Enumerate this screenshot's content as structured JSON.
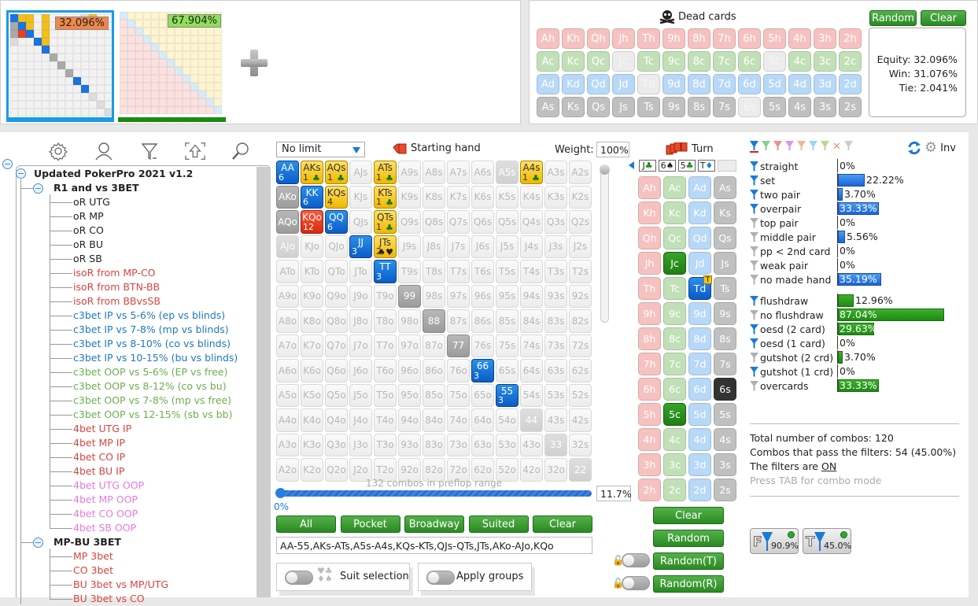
{
  "equity_panels": [
    {
      "percent": "32.096%",
      "badge_color": "#f0874a",
      "underline_color": "#1a9ae8"
    },
    {
      "percent": "67.904%",
      "badge_color": "#8ee05a",
      "underline_color": "#1a8a10"
    }
  ],
  "add_player_icon": "plus-icon",
  "dead_cards": {
    "title": "Dead cards",
    "icon": "skull-crossbones-icon",
    "random_label": "Random",
    "clear_label": "Clear",
    "rows": [
      [
        "Ah",
        "Kh",
        "Qh",
        "Jh",
        "Th",
        "9h",
        "8h",
        "7h",
        "6h",
        "5h",
        "4h",
        "3h",
        "2h"
      ],
      [
        "Ac",
        "Kc",
        "Qc",
        "Jc",
        "Tc",
        "9c",
        "8c",
        "7c",
        "6c",
        "5c",
        "4c",
        "3c",
        "2c"
      ],
      [
        "Ad",
        "Kd",
        "Qd",
        "Jd",
        "Td",
        "9d",
        "8d",
        "7d",
        "6d",
        "5d",
        "4d",
        "3d",
        "2d"
      ],
      [
        "As",
        "Ks",
        "Qs",
        "Js",
        "Ts",
        "9s",
        "8s",
        "7s",
        "6s",
        "5s",
        "4s",
        "3s",
        "2s"
      ]
    ],
    "unavailable": [
      "Jc",
      "5c",
      "Td",
      "6s"
    ]
  },
  "equity_results": {
    "equity": "Equity: 32.096%",
    "win": "Win: 31.076%",
    "tie": "Tie: 2.041%"
  },
  "toolbar": {
    "icons": [
      "gear-icon",
      "user-icon",
      "filter-icon",
      "upload-icon",
      "search-icon"
    ]
  },
  "tree": {
    "root": "Updated PokerPro 2021 v1.2",
    "groups": [
      {
        "label": "R1 and vs 3BET",
        "items": [
          {
            "label": "oR UTG",
            "color": "#222222"
          },
          {
            "label": "oR MP",
            "color": "#222222"
          },
          {
            "label": "oR CO",
            "color": "#222222"
          },
          {
            "label": "oR BU",
            "color": "#222222"
          },
          {
            "label": "oR SB",
            "color": "#222222"
          },
          {
            "label": "isoR from MP-CO",
            "color": "#d9453e"
          },
          {
            "label": "isoR from BTN-BB",
            "color": "#d9453e"
          },
          {
            "label": "isoR from BBvsSB",
            "color": "#d9453e"
          },
          {
            "label": "c3bet IP vs 5-6% (ep vs blinds)",
            "color": "#1e78c2"
          },
          {
            "label": "c3bet IP vs 7-8% (mp vs blinds)",
            "color": "#1e78c2"
          },
          {
            "label": "c3bet IP vs 8-10% (co vs blinds)",
            "color": "#1e78c2"
          },
          {
            "label": "c3bet IP vs 10-15% (bu vs blinds)",
            "color": "#1e78c2"
          },
          {
            "label": "c3bet OOP vs 5-6% (EP vs free)",
            "color": "#6ab04c"
          },
          {
            "label": "c3bet OOP vs 8-12% (co vs bu)",
            "color": "#6ab04c"
          },
          {
            "label": "c3bet OOP vs 7-8% (mp vs free)",
            "color": "#6ab04c"
          },
          {
            "label": "c3bet OOP vs 12-15% (sb vs bb)",
            "color": "#6ab04c"
          },
          {
            "label": "4bet UTG IP",
            "color": "#d9453e"
          },
          {
            "label": "4bet MP IP",
            "color": "#d9453e"
          },
          {
            "label": "4bet CO IP",
            "color": "#d9453e"
          },
          {
            "label": "4bet BU IP",
            "color": "#d9453e"
          },
          {
            "label": "4bet UTG OOP",
            "color": "#e87ae0"
          },
          {
            "label": "4bet MP OOP",
            "color": "#e87ae0"
          },
          {
            "label": "4bet CO OOP",
            "color": "#e87ae0"
          },
          {
            "label": "4bet SB OOP",
            "color": "#e87ae0"
          }
        ]
      },
      {
        "label": "MP-BU 3BET",
        "items": [
          {
            "label": "MP 3bet",
            "color": "#d9453e"
          },
          {
            "label": "CO 3bet",
            "color": "#d9453e"
          },
          {
            "label": "BU 3bet vs MP/UTG",
            "color": "#d9453e"
          },
          {
            "label": "BU 3bet vs CO",
            "color": "#d9453e"
          }
        ]
      }
    ]
  },
  "range": {
    "limit_select": "No limit",
    "starting_hand_label": "Starting hand",
    "weight_label": "Weight:",
    "weight_value": "100%",
    "combos_label": "132 combos in preflop range",
    "slider_min": "0%",
    "slider_value": "11.7%",
    "buttons": [
      "All",
      "Pocket",
      "Broadway",
      "Suited",
      "Clear"
    ],
    "range_text": "AA-55,AKs-ATs,A5s-A4s,KQs-KTs,QJs-QTs,JTs,AKo-AJo,KQo",
    "suit_selection_label": "Suit selection",
    "apply_groups_label": "Apply groups",
    "hands": [
      [
        "AA",
        "AKs",
        "AQs",
        "AJs",
        "ATs",
        "A9s",
        "A8s",
        "A7s",
        "A6s",
        "A5s",
        "A4s",
        "A3s",
        "A2s"
      ],
      [
        "AKo",
        "KK",
        "KQs",
        "KJs",
        "KTs",
        "K9s",
        "K8s",
        "K7s",
        "K6s",
        "K5s",
        "K4s",
        "K3s",
        "K2s"
      ],
      [
        "AQo",
        "KQo",
        "QQ",
        "QJs",
        "QTs",
        "Q9s",
        "Q8s",
        "Q7s",
        "Q6s",
        "Q5s",
        "Q4s",
        "Q3s",
        "Q2s"
      ],
      [
        "AJo",
        "KJo",
        "QJo",
        "JJ",
        "JTs",
        "J9s",
        "J8s",
        "J7s",
        "J6s",
        "J5s",
        "J4s",
        "J3s",
        "J2s"
      ],
      [
        "ATo",
        "KTo",
        "QTo",
        "JTo",
        "TT",
        "T9s",
        "T8s",
        "T7s",
        "T6s",
        "T5s",
        "T4s",
        "T3s",
        "T2s"
      ],
      [
        "A9o",
        "K9o",
        "Q9o",
        "J9o",
        "T9o",
        "99",
        "98s",
        "97s",
        "96s",
        "95s",
        "94s",
        "93s",
        "92s"
      ],
      [
        "A8o",
        "K8o",
        "Q8o",
        "J8o",
        "T8o",
        "98o",
        "88",
        "87s",
        "86s",
        "85s",
        "84s",
        "83s",
        "82s"
      ],
      [
        "A7o",
        "K7o",
        "Q7o",
        "J7o",
        "T7o",
        "97o",
        "87o",
        "77",
        "76s",
        "75s",
        "74s",
        "73s",
        "72s"
      ],
      [
        "A6o",
        "K6o",
        "Q6o",
        "J6o",
        "T6o",
        "96o",
        "86o",
        "76o",
        "66",
        "65s",
        "64s",
        "63s",
        "62s"
      ],
      [
        "A5o",
        "K5o",
        "Q5o",
        "J5o",
        "T5o",
        "95o",
        "85o",
        "75o",
        "65o",
        "55",
        "54s",
        "53s",
        "52s"
      ],
      [
        "A4o",
        "K4o",
        "Q4o",
        "J4o",
        "T4o",
        "94o",
        "84o",
        "74o",
        "64o",
        "54o",
        "44",
        "43s",
        "42s"
      ],
      [
        "A3o",
        "K3o",
        "Q3o",
        "J3o",
        "T3o",
        "93o",
        "83o",
        "73o",
        "63o",
        "53o",
        "43o",
        "33",
        "32s"
      ],
      [
        "A2o",
        "K2o",
        "Q2o",
        "J2o",
        "T2o",
        "92o",
        "82o",
        "72o",
        "62o",
        "52o",
        "42o",
        "32o",
        "22"
      ]
    ],
    "highlighted": {
      "AA": {
        "style": "blue",
        "count": "6"
      },
      "KK": {
        "style": "blue",
        "count": "6"
      },
      "QQ": {
        "style": "blue",
        "count": "6"
      },
      "JJ": {
        "style": "blue",
        "count": "3"
      },
      "TT": {
        "style": "blue",
        "count": "3"
      },
      "66": {
        "style": "blue",
        "count": "3"
      },
      "55": {
        "style": "blue",
        "count": "3"
      },
      "AKs": {
        "style": "yel",
        "count": "1",
        "suit": "♣"
      },
      "AQs": {
        "style": "yel",
        "count": "1",
        "suit": "♣"
      },
      "ATs": {
        "style": "yel",
        "count": "1",
        "suit": "♣"
      },
      "A4s": {
        "style": "yel",
        "count": "1",
        "suit": "♣"
      },
      "KTs": {
        "style": "yel",
        "count": "1",
        "suit": "♣"
      },
      "QTs": {
        "style": "yel",
        "count": "1",
        "suit": "♣"
      },
      "KQs": {
        "style": "yel",
        "count": "4"
      },
      "JTs": {
        "style": "yel",
        "count": "2",
        "suit": "♠♥"
      },
      "KQo": {
        "style": "red",
        "count": "12"
      },
      "AKo": {
        "style": "gry"
      },
      "AQo": {
        "style": "gry"
      },
      "AJo": {
        "style": "lg"
      },
      "A5s": {
        "style": "lg"
      },
      "99": {
        "style": "gry"
      },
      "88": {
        "style": "gry"
      },
      "77": {
        "style": "gry"
      },
      "44": {
        "style": "lg"
      },
      "33": {
        "style": "lg"
      },
      "22": {
        "style": "lg"
      }
    }
  },
  "board": {
    "street_label": "Turn",
    "cards": [
      {
        "rank": "J",
        "suit": "♣",
        "color": "#1a8a1a"
      },
      {
        "rank": "6",
        "suit": "♠",
        "color": "#222222"
      },
      {
        "rank": "5",
        "suit": "♣",
        "color": "#1a8a1a"
      },
      {
        "rank": "T",
        "suit": "♦",
        "color": "#1a80e0"
      },
      {
        "rank": "",
        "suit": "",
        "color": "#222222"
      }
    ],
    "deck": [
      [
        "Ah",
        "Ac",
        "Ad",
        "As"
      ],
      [
        "Kh",
        "Kc",
        "Kd",
        "Ks"
      ],
      [
        "Qh",
        "Qc",
        "Qd",
        "Qs"
      ],
      [
        "Jh",
        "Jc",
        "Jd",
        "Js"
      ],
      [
        "Th",
        "Tc",
        "Td",
        "Ts"
      ],
      [
        "9h",
        "9c",
        "9d",
        "9s"
      ],
      [
        "8h",
        "8c",
        "8d",
        "8s"
      ],
      [
        "7h",
        "7c",
        "7d",
        "7s"
      ],
      [
        "6h",
        "6c",
        "6d",
        "6s"
      ],
      [
        "5h",
        "5c",
        "5d",
        "5s"
      ],
      [
        "4h",
        "4c",
        "4d",
        "4s"
      ],
      [
        "3h",
        "3c",
        "3d",
        "3s"
      ],
      [
        "2h",
        "2c",
        "2d",
        "2s"
      ]
    ],
    "selected": {
      "Jc": "sel-c",
      "5c": "sel-c",
      "Td": "sel-d",
      "6s": "sel-s"
    },
    "turn_badge": "T",
    "clear_label": "Clear",
    "random_label": "Random",
    "random_t_label": "Random(T)",
    "random_r_label": "Random(R)"
  },
  "filters": {
    "inv_label": "Inv",
    "color_tabs": [
      "#1a7ad8",
      "#8ccc8c",
      "#ec9090",
      "#e690e6",
      "#f0b896",
      "#9cd8e6",
      "#b4dc84",
      "x",
      "#cccccc"
    ],
    "made_hands": [
      {
        "label": "straight",
        "active": true,
        "value": "0%",
        "pct": 0
      },
      {
        "label": "set",
        "active": true,
        "value": "22.22%",
        "pct": 22.22
      },
      {
        "label": "two pair",
        "active": true,
        "value": "3.70%",
        "pct": 3.7
      },
      {
        "label": "overpair",
        "active": true,
        "value": "33.33%",
        "pct": 33.33
      },
      {
        "label": "top pair",
        "active": false,
        "value": "0%",
        "pct": 0
      },
      {
        "label": "middle pair",
        "active": false,
        "value": "5.56%",
        "pct": 5.56
      },
      {
        "label": "pp < 2nd card",
        "active": false,
        "value": "0%",
        "pct": 0
      },
      {
        "label": "weak pair",
        "active": false,
        "value": "0%",
        "pct": 0
      },
      {
        "label": "no made hand",
        "active": false,
        "value": "35.19%",
        "pct": 35.19
      }
    ],
    "draws": [
      {
        "label": "flushdraw",
        "active": true,
        "value": "12.96%",
        "pct": 12.96
      },
      {
        "label": "no flushdraw",
        "active": false,
        "value": "87.04%",
        "pct": 87.04
      },
      {
        "label": "oesd (2 card)",
        "active": true,
        "value": "29.63%",
        "pct": 29.63
      },
      {
        "label": "oesd (1 card)",
        "active": true,
        "value": "0%",
        "pct": 0
      },
      {
        "label": "gutshot (2 crd)",
        "active": false,
        "value": "3.70%",
        "pct": 3.7
      },
      {
        "label": "gutshot (1 crd)",
        "active": true,
        "value": "0%",
        "pct": 0
      },
      {
        "label": "overcards",
        "active": false,
        "value": "33.33%",
        "pct": 33.33
      }
    ],
    "total_combos": "Total number of combos: 120",
    "pass_combos": "Combos that pass the filters: 54 (45.00%)",
    "filters_on_prefix": "The filters are ",
    "filters_on_state": "ON",
    "tab_hint": "Press TAB for combo mode",
    "flop_filter": {
      "letter": "F",
      "value": "90.9%"
    },
    "turn_filter": {
      "letter": "T",
      "value": "45.0%"
    }
  }
}
